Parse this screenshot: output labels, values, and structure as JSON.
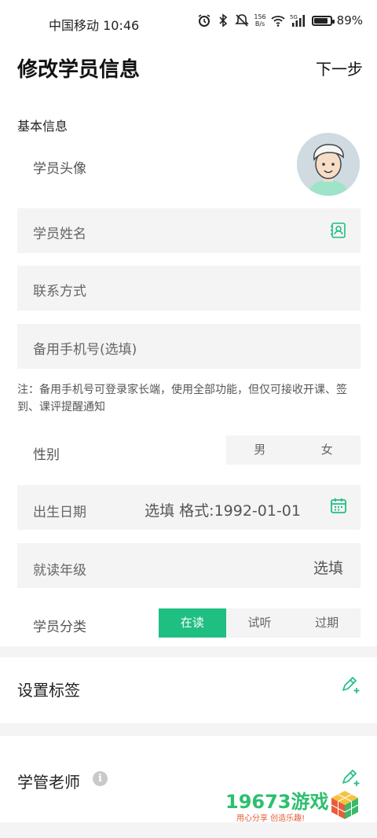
{
  "status_bar": {
    "carrier_time": "中国移动 10:46",
    "net_speed_top": "156",
    "net_speed_bottom": "B/s",
    "battery_text": "89%",
    "battery_level": 0.89,
    "signal_label": "5G"
  },
  "header": {
    "title": "修改学员信息",
    "next_label": "下一步"
  },
  "basic_info": {
    "section_title": "基本信息",
    "avatar_label": "学员头像",
    "name_placeholder": "学员姓名",
    "contact_placeholder": "联系方式",
    "backup_phone_placeholder": "备用手机号(选填)",
    "note": "注：备用手机号可登录家长端，使用全部功能，但仅可接收开课、签到、课评提醒通知",
    "gender_label": "性别",
    "gender_options": [
      "男",
      "女"
    ],
    "birthday_label": "出生日期",
    "birthday_placeholder": "选填 格式:1992-01-01",
    "grade_label": "就读年级",
    "grade_placeholder": "选填",
    "category_label": "学员分类",
    "category_options": [
      "在读",
      "试听",
      "过期"
    ],
    "category_selected": "在读"
  },
  "tags": {
    "title": "设置标签"
  },
  "teacher": {
    "title": "学管老师"
  },
  "watermark": {
    "brand": "19673游戏",
    "slogan": "用心分享 创造乐趣!"
  },
  "colors": {
    "accent": "#1fbf82",
    "field_bg": "#f4f4f4"
  }
}
